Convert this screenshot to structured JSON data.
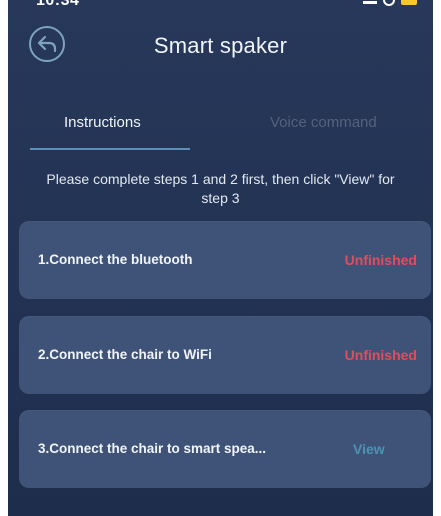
{
  "status_bar": {
    "time": "10:34"
  },
  "header": {
    "title": "Smart spaker"
  },
  "tabs": [
    {
      "label": "Instructions",
      "active": true
    },
    {
      "label": "Voice command",
      "active": false
    }
  ],
  "hint": "Please complete steps 1 and 2 first, then click \"View\" for step 3",
  "steps": [
    {
      "label": "1.Connect the bluetooth",
      "status": "Unfinished"
    },
    {
      "label": "2.Connect the chair to WiFi",
      "status": "Unfinished"
    },
    {
      "label": "3.Connect the chair to smart spea...",
      "status": "View"
    }
  ],
  "colors": {
    "background": "#223253",
    "card": "#3f5378",
    "unfinished": "#e04d5b",
    "view": "#4c93b3",
    "tab_underline": "#5f8fb8",
    "battery": "#f2cd2a"
  },
  "icons": {
    "back": "back-arrow-icon",
    "signal": "signal-icon",
    "wifi": "wifi-icon",
    "battery": "battery-icon"
  }
}
